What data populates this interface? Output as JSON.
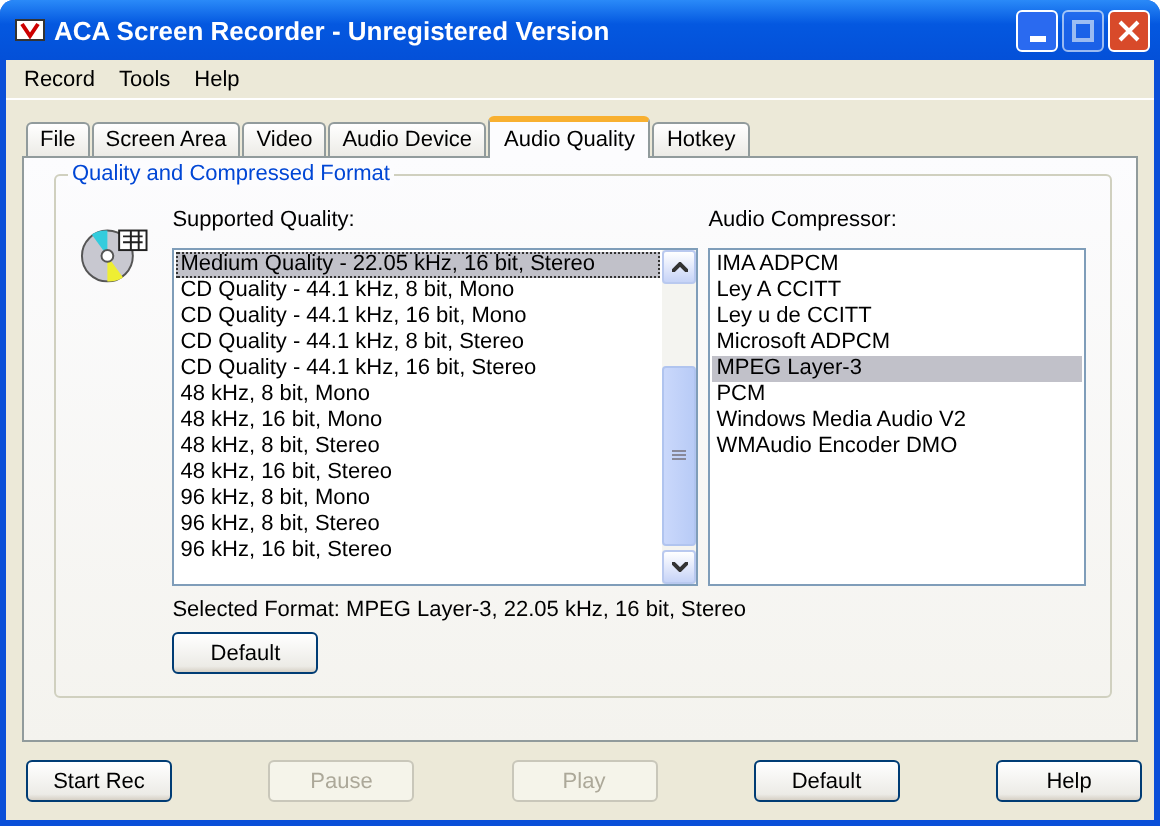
{
  "window": {
    "title": "ACA Screen Recorder - Unregistered Version"
  },
  "menu": [
    "Record",
    "Tools",
    "Help"
  ],
  "tabs": [
    {
      "label": "File",
      "selected": false
    },
    {
      "label": "Screen Area",
      "selected": false
    },
    {
      "label": "Video",
      "selected": false
    },
    {
      "label": "Audio Device",
      "selected": false
    },
    {
      "label": "Audio Quality",
      "selected": true
    },
    {
      "label": "Hotkey",
      "selected": false
    }
  ],
  "group": {
    "title": "Quality and Compressed Format",
    "quality_label": "Supported Quality:",
    "quality_items": [
      {
        "label": "Medium Quality - 22.05 kHz, 16 bit, Stereo",
        "selected": true
      },
      {
        "label": "CD Quality - 44.1 kHz, 8 bit, Mono",
        "selected": false
      },
      {
        "label": "CD Quality - 44.1 kHz, 16 bit, Mono",
        "selected": false
      },
      {
        "label": "CD Quality - 44.1 kHz, 8 bit, Stereo",
        "selected": false
      },
      {
        "label": "CD Quality - 44.1 kHz, 16 bit, Stereo",
        "selected": false
      },
      {
        "label": "48 kHz, 8 bit, Mono",
        "selected": false
      },
      {
        "label": "48 kHz, 16 bit, Mono",
        "selected": false
      },
      {
        "label": "48 kHz, 8 bit, Stereo",
        "selected": false
      },
      {
        "label": "48 kHz, 16 bit, Stereo",
        "selected": false
      },
      {
        "label": "96 kHz, 8 bit, Mono",
        "selected": false
      },
      {
        "label": "96 kHz, 8 bit, Stereo",
        "selected": false
      },
      {
        "label": "96 kHz, 16 bit, Stereo",
        "selected": false
      }
    ],
    "compressor_label": "Audio Compressor:",
    "compressor_items": [
      {
        "label": "IMA ADPCM",
        "selected": false
      },
      {
        "label": "Ley A CCITT",
        "selected": false
      },
      {
        "label": "Ley u de CCITT",
        "selected": false
      },
      {
        "label": "Microsoft ADPCM",
        "selected": false
      },
      {
        "label": "MPEG Layer-3",
        "selected": true
      },
      {
        "label": "PCM",
        "selected": false
      },
      {
        "label": "Windows Media Audio V2",
        "selected": false
      },
      {
        "label": "WMAudio Encoder DMO",
        "selected": false
      }
    ],
    "selected_format": "Selected Format: MPEG Layer-3, 22.05 kHz, 16 bit, Stereo",
    "default_button": "Default"
  },
  "buttons": [
    {
      "label": "Start Rec",
      "disabled": false
    },
    {
      "label": "Pause",
      "disabled": true
    },
    {
      "label": "Play",
      "disabled": true
    },
    {
      "label": "Default",
      "disabled": false
    },
    {
      "label": "Help",
      "disabled": false
    }
  ]
}
